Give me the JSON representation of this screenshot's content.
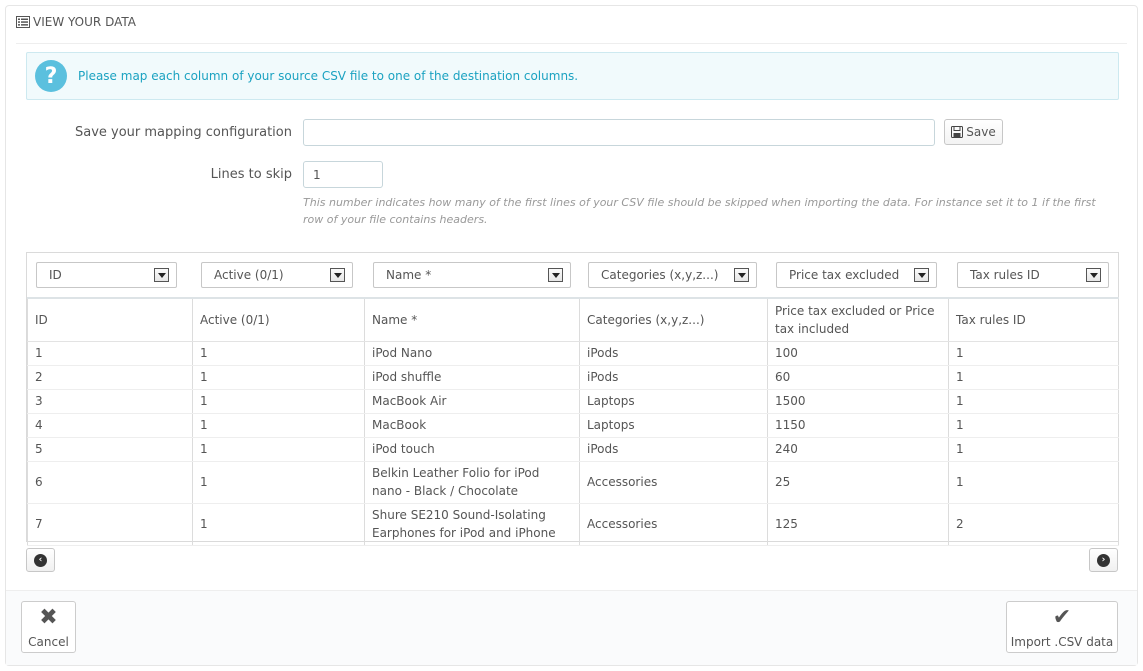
{
  "header": {
    "title": "VIEW YOUR DATA",
    "icon": "list-icon"
  },
  "alert": {
    "icon": "question-circle-icon",
    "text": "Please map each column of your source CSV file to one of the destination columns."
  },
  "mapping": {
    "label": "Save your mapping configuration",
    "value": "",
    "save_label": "Save"
  },
  "skip": {
    "label": "Lines to skip",
    "value": "1",
    "help": "This number indicates how many of the first lines of your CSV file should be skipped when importing the data. For instance set it to 1 if the first row of your file contains headers."
  },
  "selectors": [
    "ID",
    "Active (0/1)",
    "Name *",
    "Categories (x,y,z...)",
    "Price tax excluded",
    "Tax rules ID"
  ],
  "table": {
    "headers": [
      "ID",
      "Active (0/1)",
      "Name *",
      "Categories (x,y,z...)",
      "Price tax excluded or Price tax included",
      "Tax rules ID"
    ],
    "rows": [
      [
        "1",
        "1",
        "iPod Nano",
        "iPods",
        "100",
        "1"
      ],
      [
        "2",
        "1",
        "iPod shuffle",
        "iPods",
        "60",
        "1"
      ],
      [
        "3",
        "1",
        "MacBook Air",
        "Laptops",
        "1500",
        "1"
      ],
      [
        "4",
        "1",
        "MacBook",
        "Laptops",
        "1150",
        "1"
      ],
      [
        "5",
        "1",
        "iPod touch",
        "iPods",
        "240",
        "1"
      ],
      [
        "6",
        "1",
        "Belkin Leather Folio for iPod nano - Black / Chocolate",
        "Accessories",
        "25",
        "1"
      ],
      [
        "7",
        "1",
        "Shure SE210 Sound-Isolating Earphones for iPod and iPhone",
        "Accessories",
        "125",
        "2"
      ]
    ]
  },
  "footer": {
    "cancel_label": "Cancel",
    "import_label": "Import .CSV data"
  }
}
